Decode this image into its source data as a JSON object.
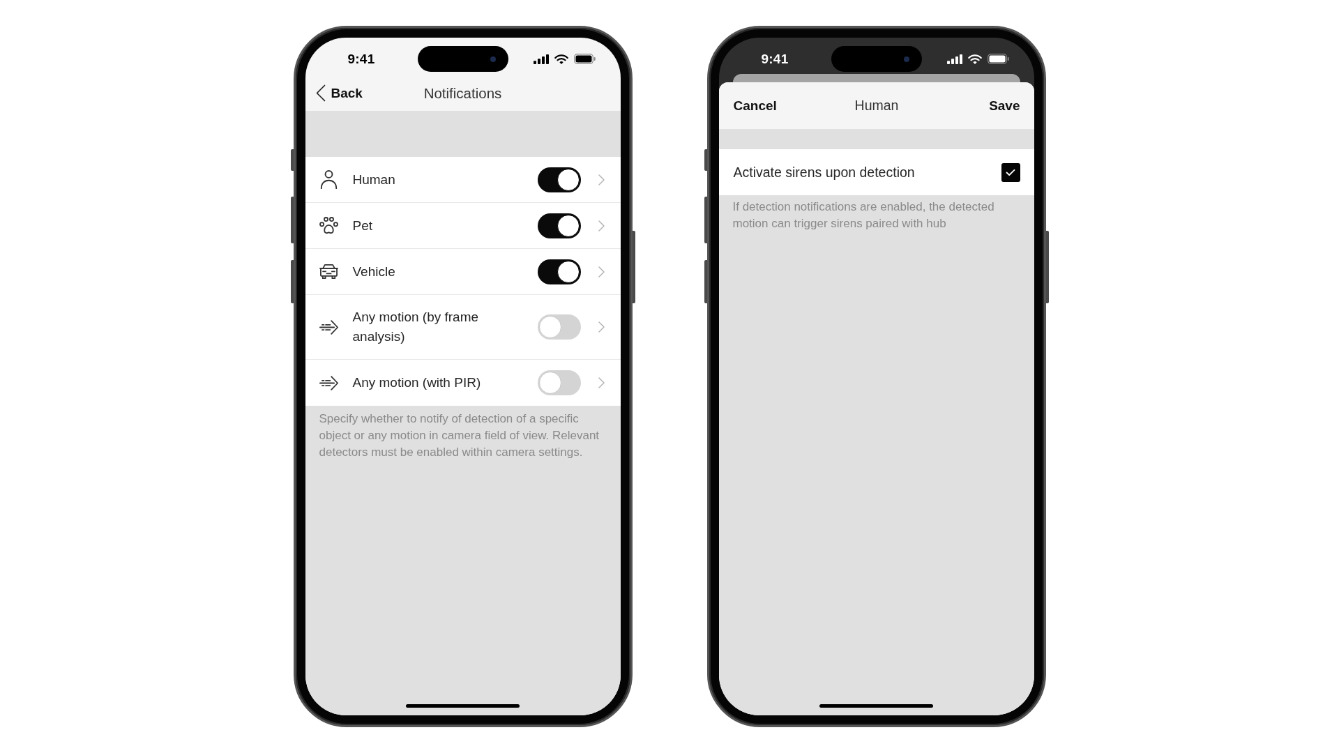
{
  "notifications_screen": {
    "status_bar": {
      "time": "9:41"
    },
    "nav": {
      "back": "Back",
      "title": "Notifications"
    },
    "rows": [
      {
        "label": "Human",
        "on": true
      },
      {
        "label": "Pet",
        "on": true
      },
      {
        "label": "Vehicle",
        "on": true
      },
      {
        "label": "Any motion (by frame analysis)",
        "on": false
      },
      {
        "label": "Any motion (with PIR)",
        "on": false
      }
    ],
    "footnote": "Specify whether to notify of detection of a specific object or any motion in camera field of view. Relevant detectors must be enabled within camera settings."
  },
  "settings_sheet": {
    "status_bar": {
      "time": "9:41"
    },
    "header": {
      "cancel": "Cancel",
      "title": "Human",
      "save": "Save"
    },
    "option": {
      "label": "Activate sirens upon detection",
      "checked": true
    },
    "footnote": "If detection notifications are enabled, the detected motion can trigger sirens paired with hub"
  }
}
